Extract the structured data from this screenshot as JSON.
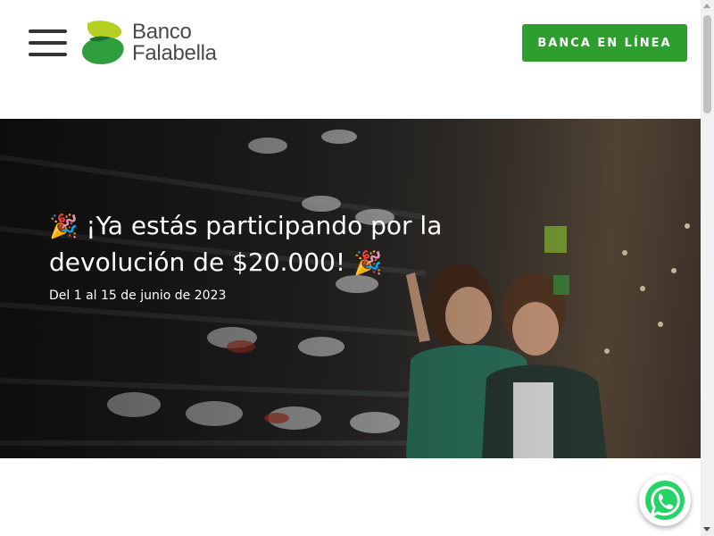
{
  "header": {
    "menu_icon": "hamburger-menu-icon",
    "logo": {
      "line1": "Banco",
      "line2": "Falabella",
      "colors": {
        "light_green": "#b5cf23",
        "dark_green": "#2e9e3f"
      }
    },
    "cta_label": "BANCA EN LÍNEA",
    "cta_color": "#2e9e2e"
  },
  "hero": {
    "title_part1": "¡Ya estás participando por la devolución de $20.000!",
    "subtitle": "Del 1 al 15 de junio de 2023",
    "party_emoji": "🎉",
    "image_desc_icon": "store-shelves-photo"
  },
  "floating": {
    "whatsapp_icon": "whatsapp-icon",
    "whatsapp_color": "#25d366"
  }
}
